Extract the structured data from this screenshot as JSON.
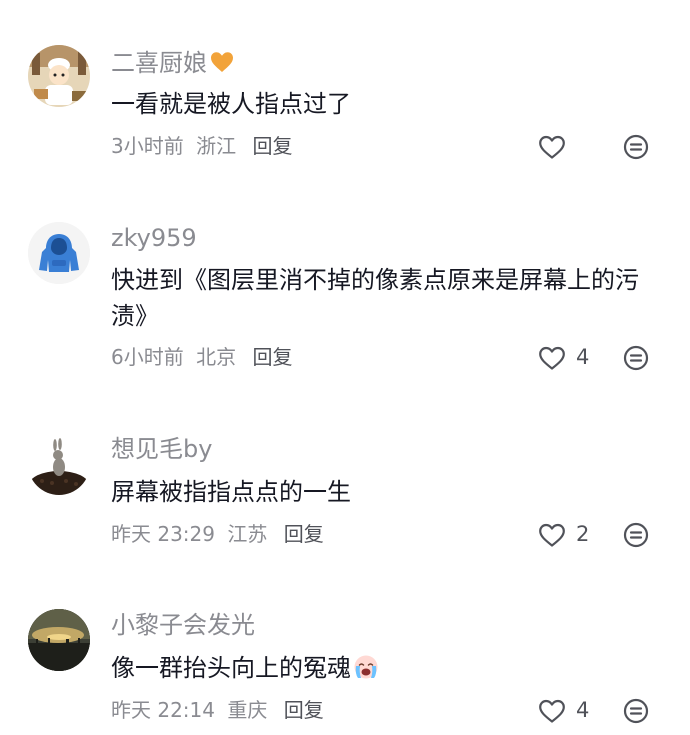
{
  "comments": [
    {
      "username": "二喜厨娘",
      "username_emoji": "orange-heart-icon",
      "text": "一看就是被人指点过了",
      "time": "3小时前",
      "location": "浙江",
      "reply_label": "回复",
      "likes": ""
    },
    {
      "username": "zky959",
      "text": "快进到《图层里消不掉的像素点原来是屏幕上的污渍》",
      "time": "6小时前",
      "location": "北京",
      "reply_label": "回复",
      "likes": "4"
    },
    {
      "username": "想见毛by",
      "text": "屏幕被指指点点的一生",
      "time": "昨天 23:29",
      "location": "江苏",
      "reply_label": "回复",
      "likes": "2"
    },
    {
      "username": "小黎子会发光",
      "text": "像一群抬头向上的冤魂",
      "text_emoji": "crying-face-icon",
      "time": "昨天 22:14",
      "location": "重庆",
      "reply_label": "回复",
      "likes": "4"
    }
  ],
  "colors": {
    "primary_text": "#161823",
    "secondary_text": "#8a8b91",
    "icon": "#505259",
    "heart_emoji": "#f2a33a"
  }
}
